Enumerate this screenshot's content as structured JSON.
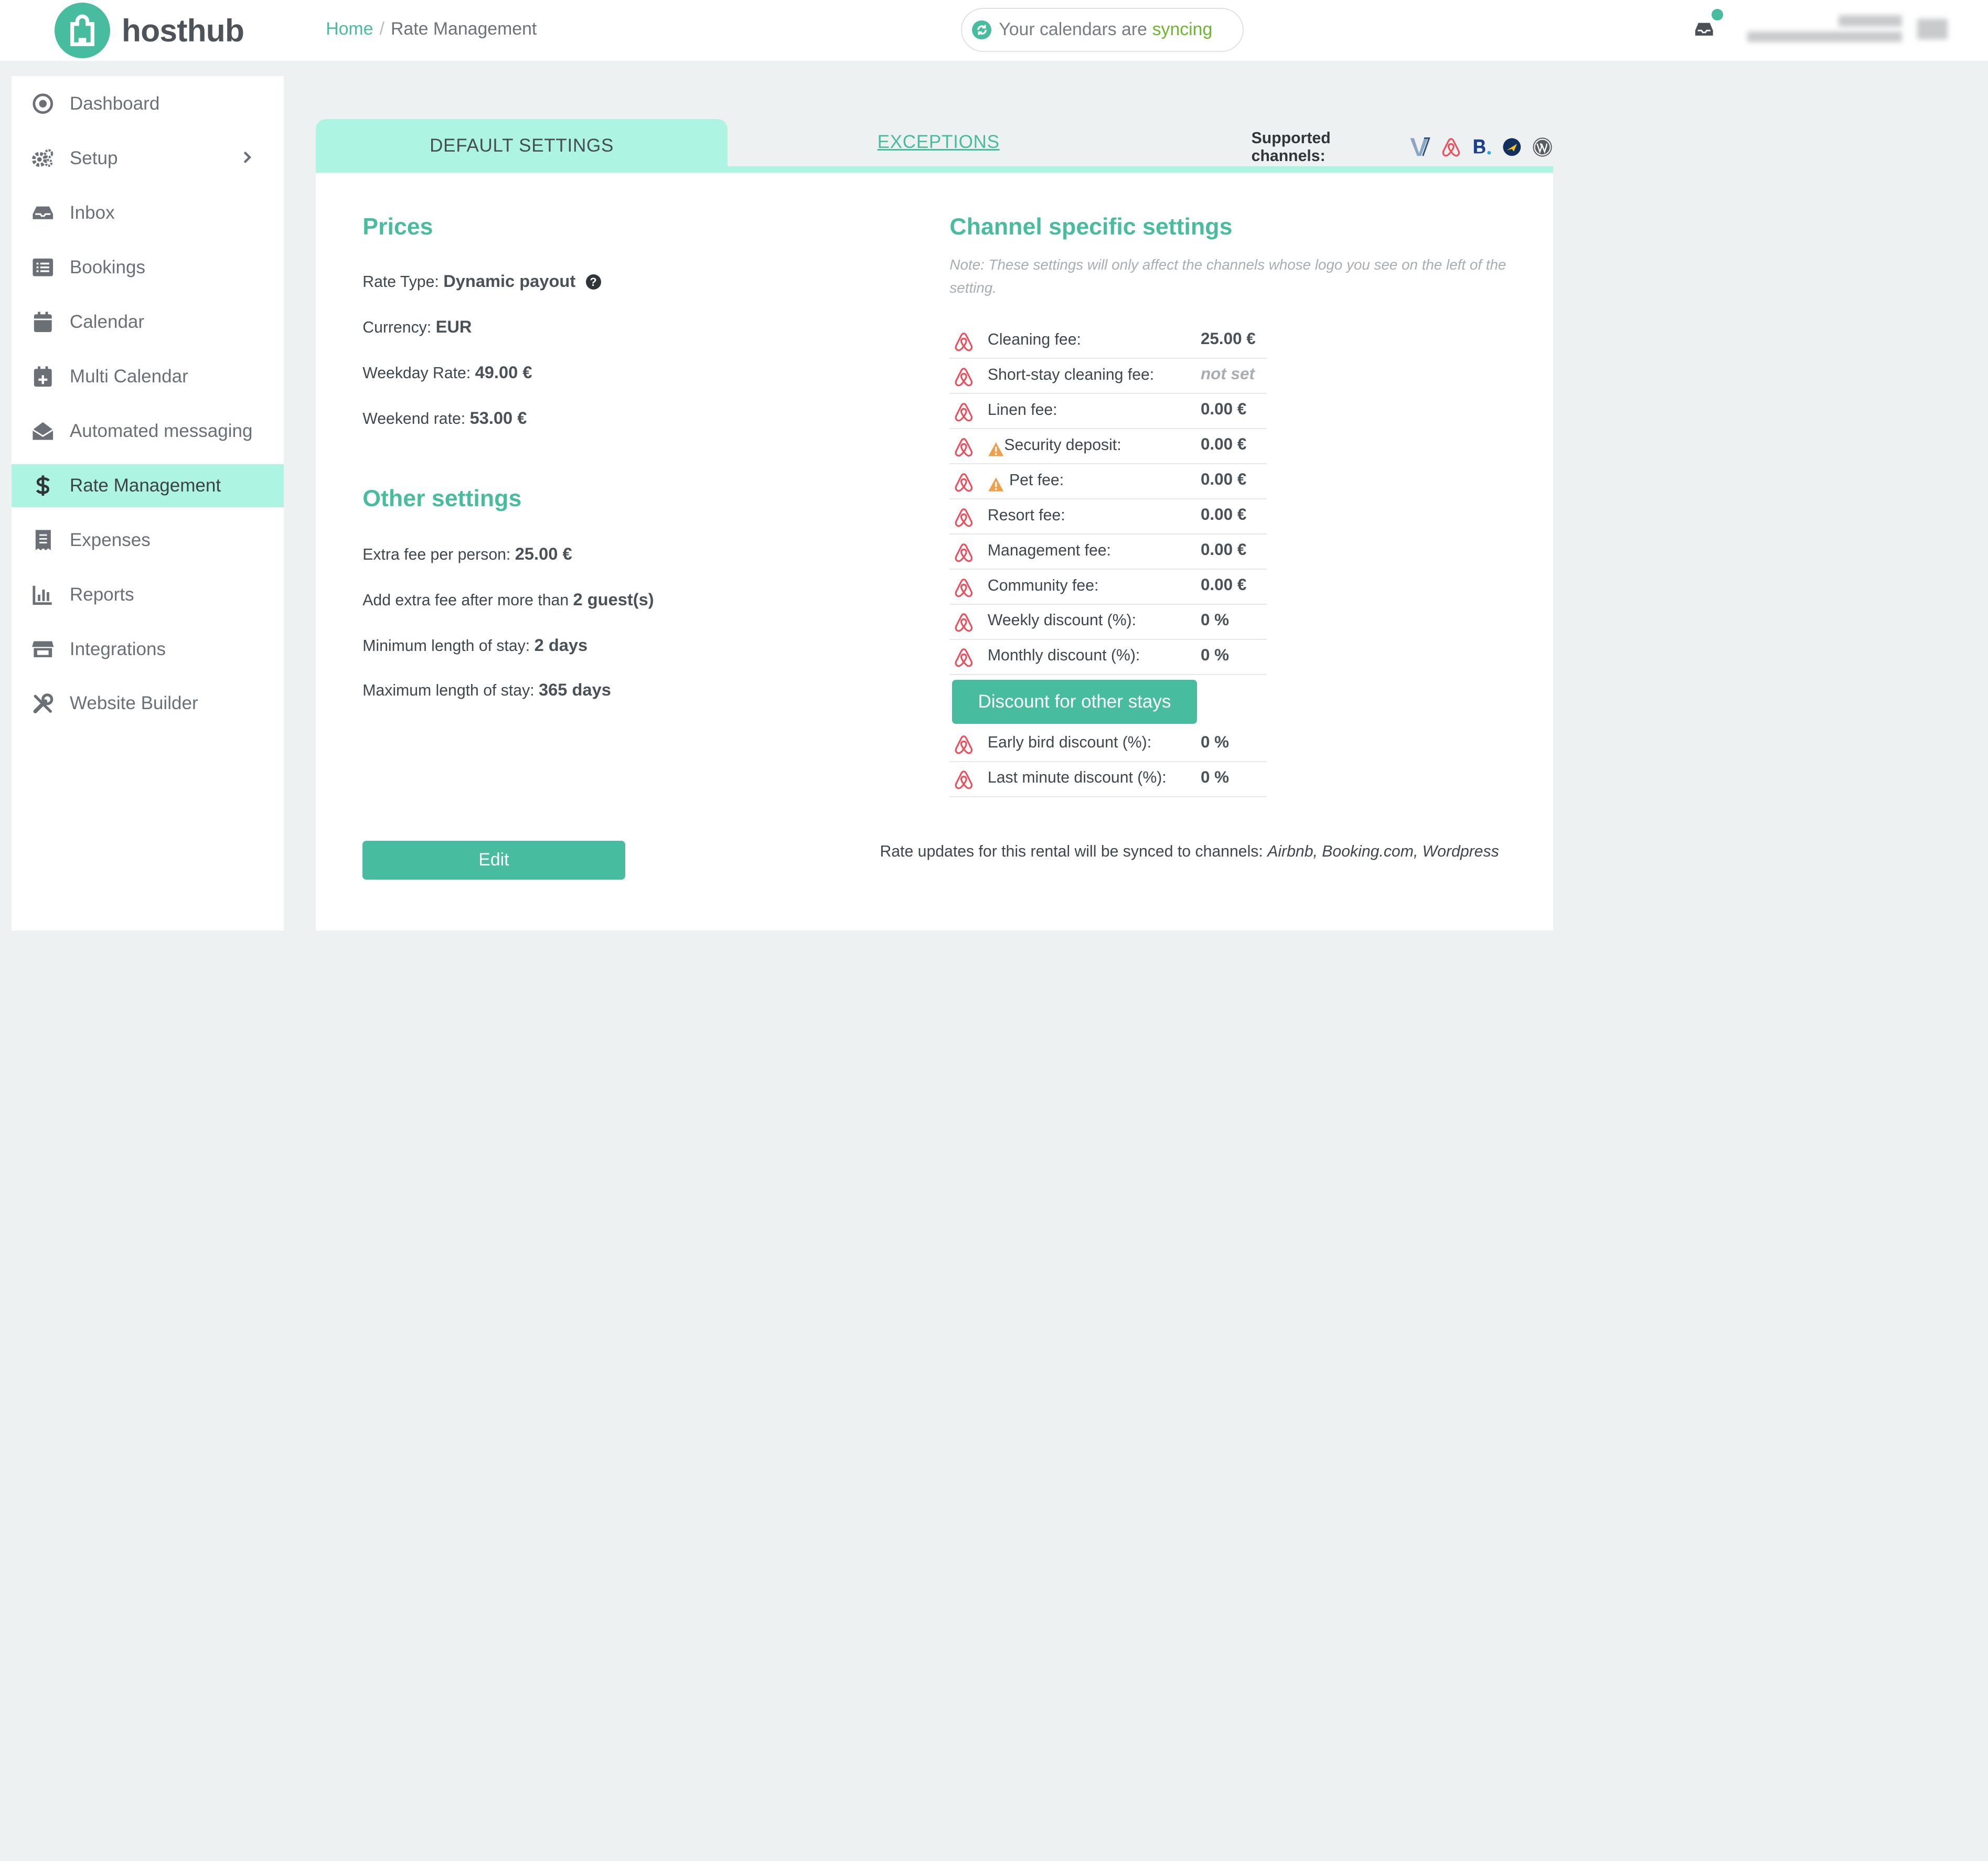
{
  "brand": {
    "name": "hosthub",
    "accent": "#48bc9e",
    "tab_bg": "#aef4e3"
  },
  "breadcrumb": {
    "home": "Home",
    "separator": "/",
    "current": "Rate Management"
  },
  "sync": {
    "prefix": "Your calendars are",
    "status": "syncing"
  },
  "sidebar": {
    "items": [
      {
        "label": "Dashboard",
        "icon": "dashboard-icon"
      },
      {
        "label": "Setup",
        "icon": "gears-icon"
      },
      {
        "label": "Inbox",
        "icon": "inbox-icon"
      },
      {
        "label": "Bookings",
        "icon": "list-icon"
      },
      {
        "label": "Calendar",
        "icon": "calendar-icon"
      },
      {
        "label": "Multi Calendar",
        "icon": "calendar-plus-icon"
      },
      {
        "label": "Automated messaging",
        "icon": "envelope-open-icon"
      },
      {
        "label": "Rate Management",
        "icon": "dollar-icon",
        "active": true
      },
      {
        "label": "Expenses",
        "icon": "receipt-icon"
      },
      {
        "label": "Reports",
        "icon": "bar-chart-icon"
      },
      {
        "label": "Integrations",
        "icon": "store-icon"
      },
      {
        "label": "Website Builder",
        "icon": "tools-icon"
      }
    ]
  },
  "tabs": {
    "default": "DEFAULT SETTINGS",
    "exceptions": "EXCEPTIONS",
    "supported_channels": "Supported channels:",
    "channel_icons": [
      "vrbo-icon",
      "airbnb-icon",
      "booking-icon",
      "expedia-icon",
      "wordpress-icon"
    ]
  },
  "prices": {
    "title": "Prices",
    "rate_type_label": "Rate Type:",
    "rate_type": "Dynamic payout",
    "currency_label": "Currency:",
    "currency": "EUR",
    "weekday_label": "Weekday Rate:",
    "weekday": "49.00 €",
    "weekend_label": "Weekend rate:",
    "weekend": "53.00 €"
  },
  "other": {
    "title": "Other settings",
    "extra_fee_label": "Extra fee per person:",
    "extra_fee": "25.00 €",
    "extra_after_label": "Add extra fee after more than",
    "extra_after": "2 guest(s)",
    "min_stay_label": "Minimum length of stay:",
    "min_stay": "2 days",
    "max_stay_label": "Maximum length of stay:",
    "max_stay": "365 days"
  },
  "channel_settings": {
    "title": "Channel specific settings",
    "note": "Note: These settings will only affect the channels whose logo you see on the left of the setting.",
    "fees": [
      {
        "label": "Cleaning fee:",
        "value": "25.00 €"
      },
      {
        "label": "Short-stay cleaning fee:",
        "value": "not set",
        "muted": true
      },
      {
        "label": "Linen fee:",
        "value": "0.00 €"
      },
      {
        "label": "Security deposit:",
        "value": "0.00 €",
        "warning": true
      },
      {
        "label": "Pet fee:",
        "value": "0.00 €",
        "warning": true
      },
      {
        "label": "Resort fee:",
        "value": "0.00 €"
      },
      {
        "label": "Management fee:",
        "value": "0.00 €"
      },
      {
        "label": "Community fee:",
        "value": "0.00 €"
      },
      {
        "label": "Weekly discount (%):",
        "value": "0 %"
      },
      {
        "label": "Monthly discount (%):",
        "value": "0 %"
      }
    ],
    "discount_button": "Discount for other stays",
    "extra_discounts": [
      {
        "label": "Early bird discount (%):",
        "value": "0 %"
      },
      {
        "label": "Last minute discount (%):",
        "value": "0 %"
      }
    ]
  },
  "footer": {
    "edit": "Edit",
    "sync_note_prefix": "Rate updates for this rental will be synced to channels:",
    "sync_channels": "Airbnb, Booking.com, Wordpress"
  }
}
